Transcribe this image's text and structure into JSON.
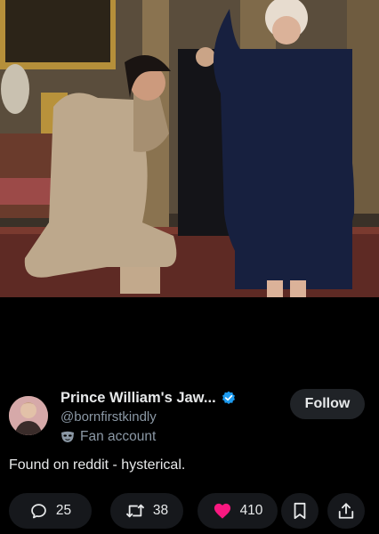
{
  "post": {
    "author_name": "Prince William's Jaw...",
    "handle": "@bornfirstkindly",
    "account_label": "Fan account",
    "follow_label": "Follow",
    "text": "Found on reddit - hysterical."
  },
  "actions": {
    "replies": "25",
    "reposts": "38",
    "likes": "410"
  },
  "colors": {
    "verified": "#1d9bf0",
    "like": "#f91880",
    "background": "#000000",
    "secondary_text": "#8b98a5"
  },
  "icons": {
    "verified": "verified-badge-icon",
    "label": "mask-icon",
    "reply": "speech-bubble-icon",
    "repost": "repost-icon",
    "like": "heart-icon",
    "bookmark": "bookmark-icon",
    "share": "share-icon"
  }
}
